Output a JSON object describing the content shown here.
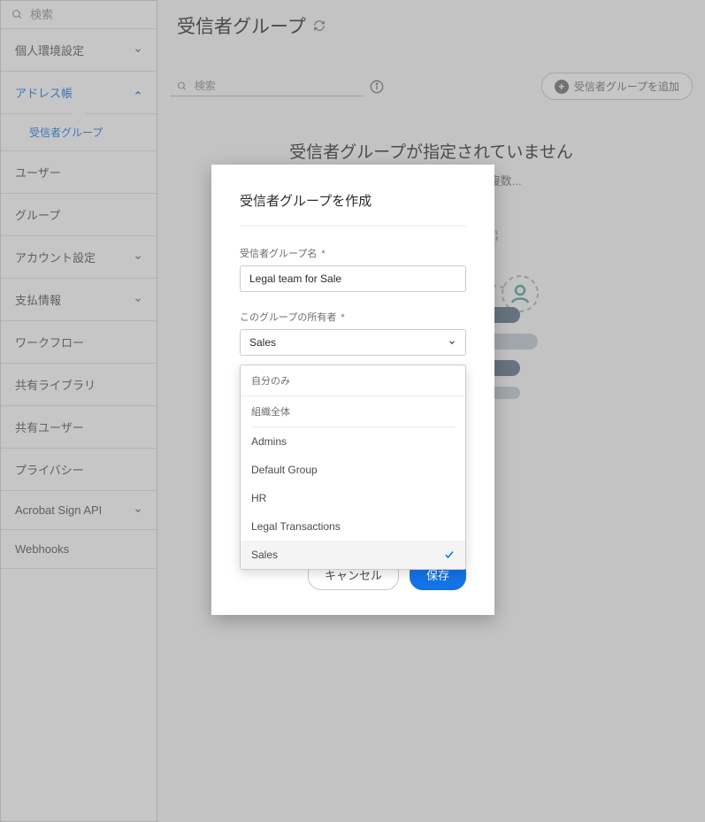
{
  "sidebar": {
    "search_placeholder": "検索",
    "items": [
      {
        "label": "個人環境設定",
        "expandable": true,
        "open": false
      },
      {
        "label": "アドレス帳",
        "expandable": true,
        "open": true,
        "active": true
      },
      {
        "label": "ユーザー"
      },
      {
        "label": "グループ"
      },
      {
        "label": "アカウント設定",
        "expandable": true,
        "open": false
      },
      {
        "label": "支払情報",
        "expandable": true,
        "open": false
      },
      {
        "label": "ワークフロー"
      },
      {
        "label": "共有ライブラリ"
      },
      {
        "label": "共有ユーザー"
      },
      {
        "label": "プライバシー"
      },
      {
        "label": "Acrobat Sign API",
        "expandable": true,
        "open": false
      },
      {
        "label": "Webhooks"
      }
    ],
    "sub_item": "受信者グループ"
  },
  "page": {
    "title": "受信者グループ",
    "toolbar_search_placeholder": "検索",
    "add_button": "受信者グループを追加",
    "empty_title": "受信者グループが指定されていません",
    "empty_sub": "受信者グループを追加して、複数..."
  },
  "modal": {
    "title": "受信者グループを作成",
    "name_label": "受信者グループ名 ",
    "name_value": "Legal team for Sale",
    "owner_label": "このグループの所有者 ",
    "owner_selected": "Sales",
    "options_top": [
      "自分のみ",
      "組織全体"
    ],
    "options_groups": [
      "Admins",
      "Default Group",
      "HR",
      "Legal Transactions",
      "Sales"
    ],
    "selected_option": "Sales",
    "cancel": "キャンセル",
    "save": "保存",
    "asterisk": "*"
  }
}
